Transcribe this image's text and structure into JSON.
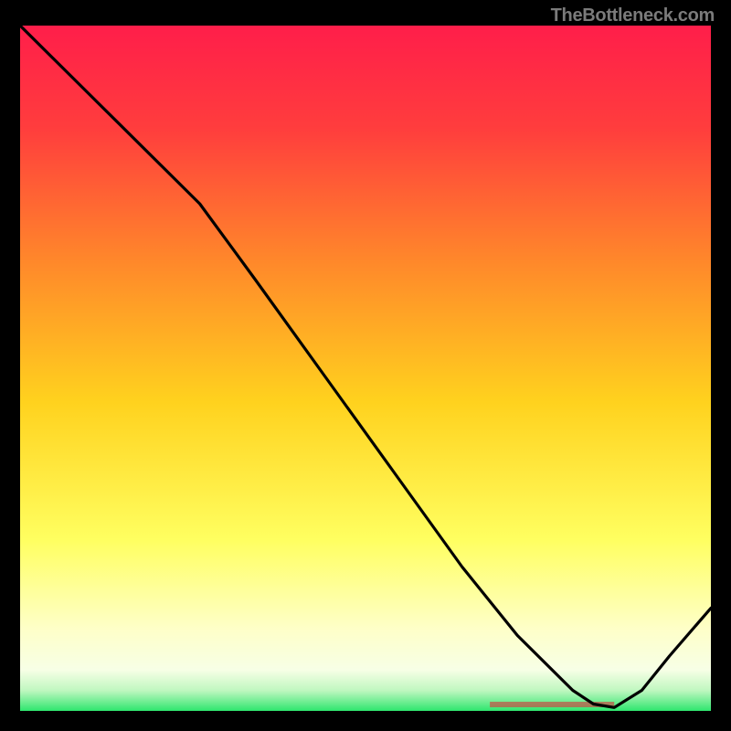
{
  "watermark": "TheBottleneck.com",
  "bottom_label": "",
  "colors": {
    "top": "#ff1e4a",
    "upper_mid": "#ff7a33",
    "mid": "#ffd21e",
    "lower_mid": "#ffff7a",
    "pale": "#feffd9",
    "green": "#2ee66e",
    "line": "#000000"
  },
  "chart_data": {
    "type": "line",
    "title": "",
    "xlabel": "",
    "ylabel": "",
    "xlim": [
      0,
      100
    ],
    "ylim": [
      0,
      100
    ],
    "grid": false,
    "legend": false,
    "series": [
      {
        "name": "curve",
        "x": [
          0,
          4,
          10,
          18,
          26,
          34,
          44,
          54,
          64,
          72,
          80,
          83,
          86,
          90,
          94,
          100
        ],
        "y": [
          100,
          96,
          90,
          82,
          74,
          63,
          49,
          35,
          21,
          11,
          3,
          1,
          0.5,
          3,
          8,
          15
        ]
      }
    ],
    "background_gradient_stops": [
      {
        "pct": 0,
        "color": "#ff1e4a"
      },
      {
        "pct": 15,
        "color": "#ff3d3d"
      },
      {
        "pct": 35,
        "color": "#ff8a2a"
      },
      {
        "pct": 55,
        "color": "#ffd21e"
      },
      {
        "pct": 75,
        "color": "#ffff60"
      },
      {
        "pct": 88,
        "color": "#feffc8"
      },
      {
        "pct": 94,
        "color": "#f7ffe6"
      },
      {
        "pct": 97,
        "color": "#c0f7c0"
      },
      {
        "pct": 100,
        "color": "#2ee66e"
      }
    ],
    "marker_band": {
      "x_start": 68,
      "x_end": 86,
      "label": ""
    }
  }
}
